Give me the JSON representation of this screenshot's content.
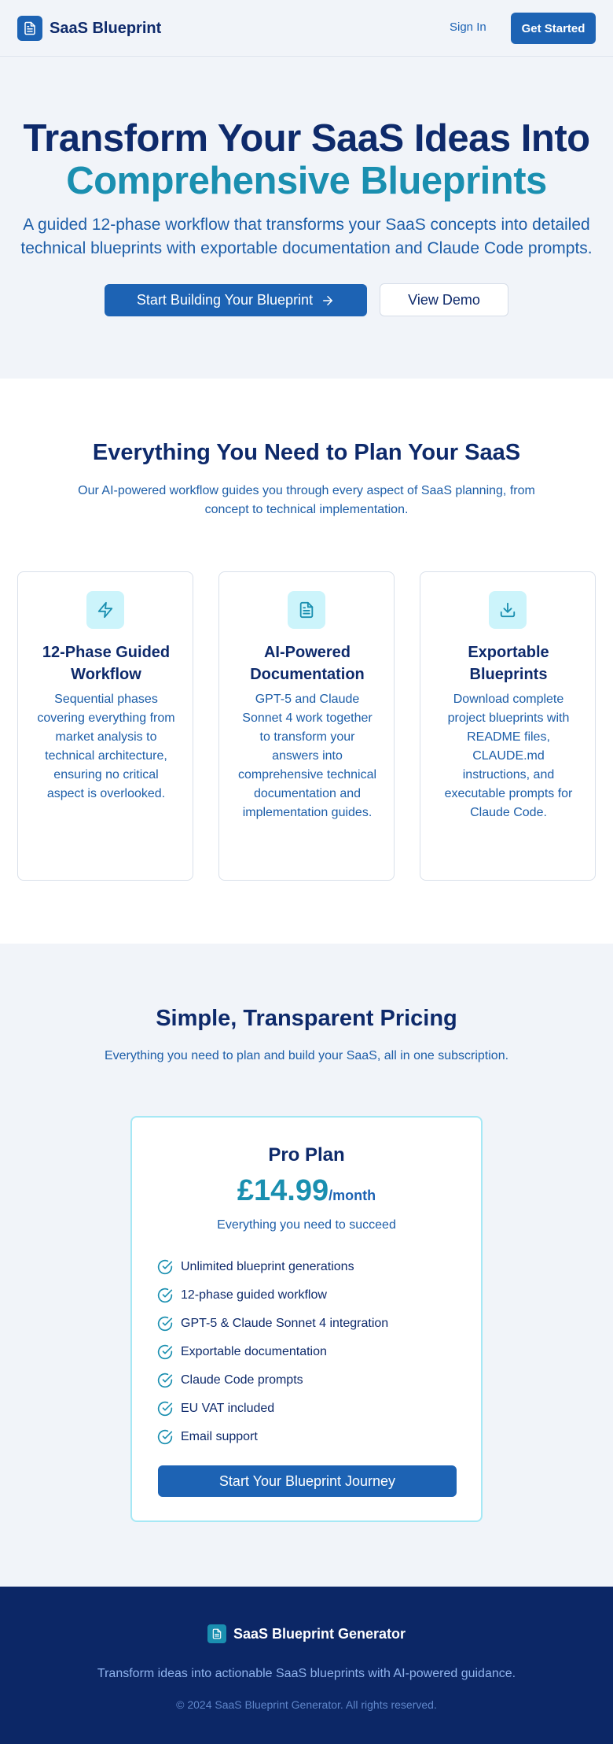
{
  "header": {
    "brand": "SaaS Blueprint",
    "signin_label": "Sign In",
    "get_started_label": "Get Started"
  },
  "hero": {
    "title_line1": "Transform Your SaaS Ideas Into",
    "title_line2": "Comprehensive Blueprints",
    "subtitle": "A guided 12-phase workflow that transforms your SaaS concepts into detailed technical blueprints with exportable documentation and Claude Code prompts.",
    "primary_cta": "Start Building Your Blueprint",
    "secondary_cta": "View Demo"
  },
  "features": {
    "title": "Everything You Need to Plan Your SaaS",
    "subtitle": "Our AI-powered workflow guides you through every aspect of SaaS planning, from concept to technical implementation.",
    "cards": [
      {
        "icon": "lightning-icon",
        "title": "12-Phase Guided Workflow",
        "description": "Sequential phases covering everything from market analysis to technical architecture, ensuring no critical aspect is overlooked."
      },
      {
        "icon": "document-icon",
        "title": "AI-Powered Documentation",
        "description": "GPT-5 and Claude Sonnet 4 work together to transform your answers into comprehensive technical documentation and implementation guides."
      },
      {
        "icon": "download-icon",
        "title": "Exportable Blueprints",
        "description": "Download complete project blueprints with README files, CLAUDE.md instructions, and executable prompts for Claude Code."
      }
    ]
  },
  "pricing": {
    "title": "Simple, Transparent Pricing",
    "subtitle": "Everything you need to plan and build your SaaS, all in one subscription.",
    "plan": {
      "name": "Pro Plan",
      "price": "£14.99",
      "period": "/month",
      "tagline": "Everything you need to succeed",
      "features": [
        "Unlimited blueprint generations",
        "12-phase guided workflow",
        "GPT-5 & Claude Sonnet 4 integration",
        "Exportable documentation",
        "Claude Code prompts",
        "EU VAT included",
        "Email support"
      ],
      "cta": "Start Your Blueprint Journey"
    }
  },
  "footer": {
    "brand": "SaaS Blueprint Generator",
    "tagline": "Transform ideas into actionable SaaS blueprints with AI-powered guidance.",
    "copyright": "© 2024 SaaS Blueprint Generator. All rights reserved."
  },
  "colors": {
    "primary": "#1d63b4",
    "accent": "#1a8fb0",
    "navy": "#0e2a6b",
    "footer_bg": "#0c2766"
  }
}
